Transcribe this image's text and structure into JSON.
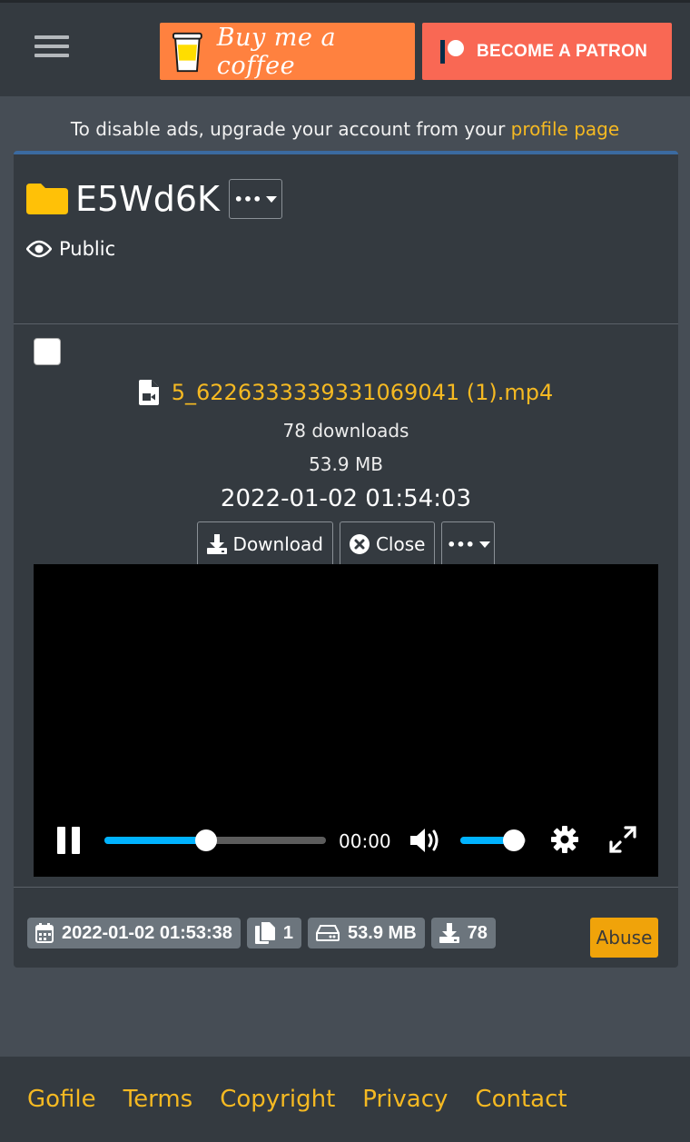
{
  "header": {
    "menu_icon": "hamburger-icon",
    "coffee_label": "Buy me a coffee",
    "patron_label": "BECOME A PATRON",
    "colors": {
      "coffee": "#ff813f",
      "patron": "#f96854"
    }
  },
  "notice": {
    "text": "To disable ads, upgrade your account from your ",
    "link": "profile page"
  },
  "folder": {
    "icon": "folder-icon",
    "name": "E5Wd6K",
    "options_label": "•••",
    "visibility_icon": "eye-icon",
    "visibility": "Public"
  },
  "file": {
    "icon": "file-video-icon",
    "name": "5_6226333339331069041 (1).mp4",
    "downloads": "78 downloads",
    "size": "53.9 MB",
    "date": "2022-01-02 01:54:03",
    "actions": {
      "download": "Download",
      "close": "Close",
      "more": "•••"
    }
  },
  "player": {
    "time": "00:00",
    "progress": 0.46,
    "volume": 0.82,
    "accent": "#00b3ff"
  },
  "stats": {
    "created": "2022-01-02 01:53:38",
    "files": "1",
    "total_size": "53.9 MB",
    "downloads": "78",
    "abuse": "Abuse"
  },
  "footer": {
    "links": [
      "Gofile",
      "Terms",
      "Copyright",
      "Privacy",
      "Contact"
    ]
  },
  "theme": {
    "link": "#f5b922",
    "card": "#343a40",
    "bg": "#464d55"
  }
}
